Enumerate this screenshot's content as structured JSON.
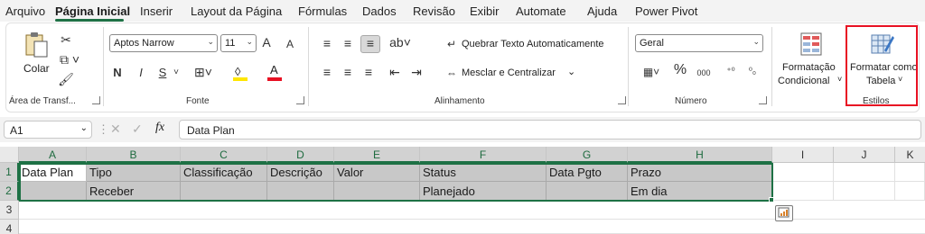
{
  "menu": {
    "tabs": [
      "Arquivo",
      "Página Inicial",
      "Inserir",
      "Layout da Página",
      "Fórmulas",
      "Dados",
      "Revisão",
      "Exibir",
      "Automate",
      "Ajuda",
      "Power Pivot"
    ],
    "active": "Página Inicial"
  },
  "clipboard": {
    "paste_label": "Colar",
    "group_label": "Área de Transf..."
  },
  "font": {
    "name": "Aptos Narrow",
    "size": "11",
    "group_label": "Fonte",
    "bold": "N",
    "italic": "I",
    "underline": "S",
    "grow": "A",
    "shrink": "A",
    "color_letter": "A",
    "underline_color": "#e81123",
    "highlight_color": "#ffe600"
  },
  "alignment": {
    "wrap_label": "Quebrar Texto Automaticamente",
    "merge_label": "Mesclar e Centralizar",
    "group_label": "Alinhamento"
  },
  "number": {
    "format": "Geral",
    "percent": "%",
    "thousands": "000",
    "group_label": "Número"
  },
  "styles": {
    "conditional_line1": "Formatação",
    "conditional_line2": "Condicional",
    "table_line1": "Formatar como",
    "table_line2": "Tabela",
    "group_label": "Estilos",
    "highlight_color": "#e81123"
  },
  "formula_bar": {
    "cell_ref": "A1",
    "fx": "fx",
    "content": "Data Plan"
  },
  "sheet": {
    "columns": [
      "A",
      "B",
      "C",
      "D",
      "E",
      "F",
      "G",
      "H",
      "I",
      "J",
      "K"
    ],
    "rows": [
      "1",
      "2",
      "3",
      "4"
    ],
    "row1": [
      "Data Plan",
      "Tipo",
      "Classificação",
      "Descrição",
      "Valor",
      "Status",
      "Data Pgto",
      "Prazo"
    ],
    "row2": [
      "",
      "Receber",
      "",
      "",
      "",
      "Planejado",
      "",
      "Em dia"
    ],
    "accent": "#1e7145"
  }
}
